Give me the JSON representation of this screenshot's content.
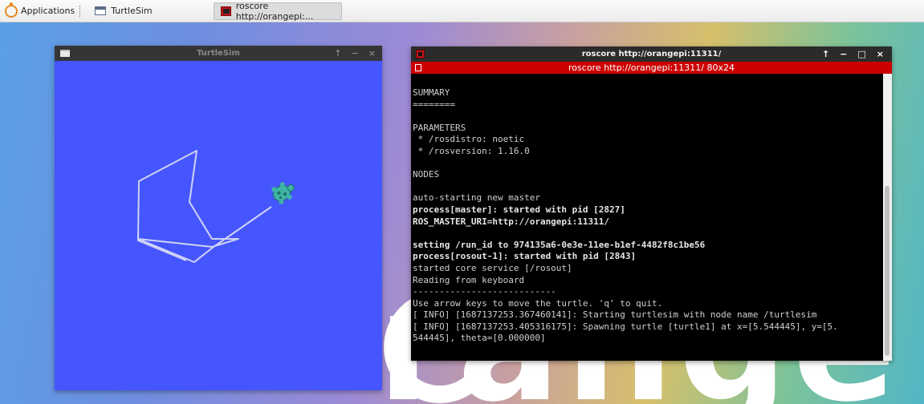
{
  "taskbar": {
    "applications_label": "Applications",
    "tasks": [
      {
        "label": "TurtleSim",
        "active": false
      },
      {
        "label": "roscore http://orangepi:...",
        "active": true
      }
    ]
  },
  "desktop": {
    "brand_text": "range pi"
  },
  "turtlesim_window": {
    "title": "TurtleSim",
    "controls": [
      "↑",
      "−",
      "×"
    ],
    "background_color": "#4556ff",
    "path_color": "#cfd3f5",
    "turtle_color": "#3fb3a6"
  },
  "terminal_window": {
    "title": "roscore http://orangepi:11311/",
    "controls": [
      "↑",
      "−",
      "□",
      "×"
    ],
    "subtitle": "roscore http://orangepi:11311/ 80x24",
    "lines": [
      {
        "text": "SUMMARY",
        "bold": false
      },
      {
        "text": "========",
        "bold": false
      },
      {
        "text": "",
        "bold": false
      },
      {
        "text": "PARAMETERS",
        "bold": false
      },
      {
        "text": " * /rosdistro: noetic",
        "bold": false
      },
      {
        "text": " * /rosversion: 1.16.0",
        "bold": false
      },
      {
        "text": "",
        "bold": false
      },
      {
        "text": "NODES",
        "bold": false
      },
      {
        "text": "",
        "bold": false
      },
      {
        "text": "auto-starting new master",
        "bold": false
      },
      {
        "text": "process[master]: started with pid [2827]",
        "bold": true
      },
      {
        "text": "ROS_MASTER_URI=http://orangepi:11311/",
        "bold": true
      },
      {
        "text": "",
        "bold": false
      },
      {
        "text": "setting /run_id to 974135a6-0e3e-11ee-b1ef-4482f8c1be56",
        "bold": true
      },
      {
        "text": "process[rosout-1]: started with pid [2843]",
        "bold": true
      },
      {
        "text": "started core service [/rosout]",
        "bold": false
      },
      {
        "text": "Reading from keyboard",
        "bold": false
      },
      {
        "text": "---------------------------",
        "bold": false
      },
      {
        "text": "Use arrow keys to move the turtle. 'q' to quit.",
        "bold": false
      },
      {
        "text": "[ INFO] [1687137253.367460141]: Starting turtlesim with node name /turtlesim",
        "bold": false
      },
      {
        "text": "[ INFO] [1687137253.405316175]: Spawning turtle [turtle1] at x=[5.544445], y=[5.",
        "bold": false
      },
      {
        "text": "544445], theta=[0.000000]",
        "bold": false
      }
    ]
  }
}
